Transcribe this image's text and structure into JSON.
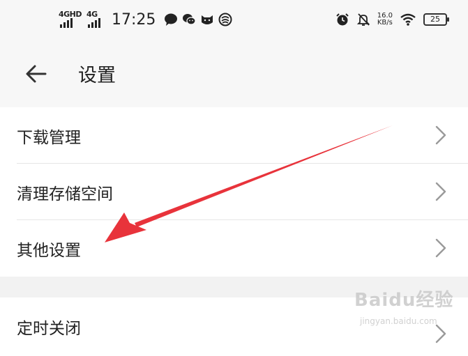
{
  "status_bar": {
    "signal1_label": "4GHD",
    "signal2_label": "4G",
    "time": "17:25",
    "net_speed_value": "16.0",
    "net_speed_unit": "KB/s",
    "battery": "25"
  },
  "header": {
    "title": "设置"
  },
  "settings_list": {
    "items": [
      {
        "label": "下载管理"
      },
      {
        "label": "清理存储空间"
      },
      {
        "label": "其他设置"
      },
      {
        "label": "定时关闭"
      }
    ]
  },
  "annotation": {
    "arrow_color": "#e8333b"
  },
  "watermark": {
    "brand": "Baidu经验",
    "url": "jingyan.baidu.com"
  }
}
